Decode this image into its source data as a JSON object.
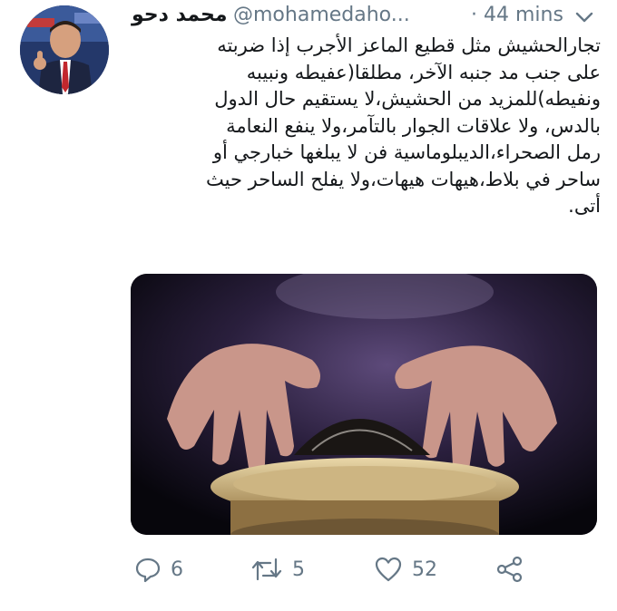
{
  "tweet": {
    "author": {
      "name": "محمد دحو",
      "handle": "@mohamedaho...",
      "avatar_desc": "avatar"
    },
    "time": "· 44 mins",
    "menu_icon": "chevron-down-icon",
    "text_lines": [
      "تجارالحشيش مثل قطيع الماعز الأجرب إذا ضربته",
      "على جنب مد جنبه الآخر، مطلقا(عفيطه ونبيبه",
      "ونفيطه)للمزيد من الحشيش،لا يستقيم حال الدول",
      "بالدس، ولا علاقات الجوار بالتآمر،ولا ينفع النعامة",
      "رمل الصحراء،الديبلوماسية فن لا يبلغها خبارجي أو",
      "ساحر في بلاط،هيهات هيهات،ولا يفلح الساحر حيث",
      "أتى."
    ],
    "actions": {
      "reply_count": "6",
      "retweet_count": "5",
      "like_count": "52"
    }
  },
  "colors": {
    "text": "#14171a",
    "secondary": "#657786",
    "background": "#ffffff"
  }
}
